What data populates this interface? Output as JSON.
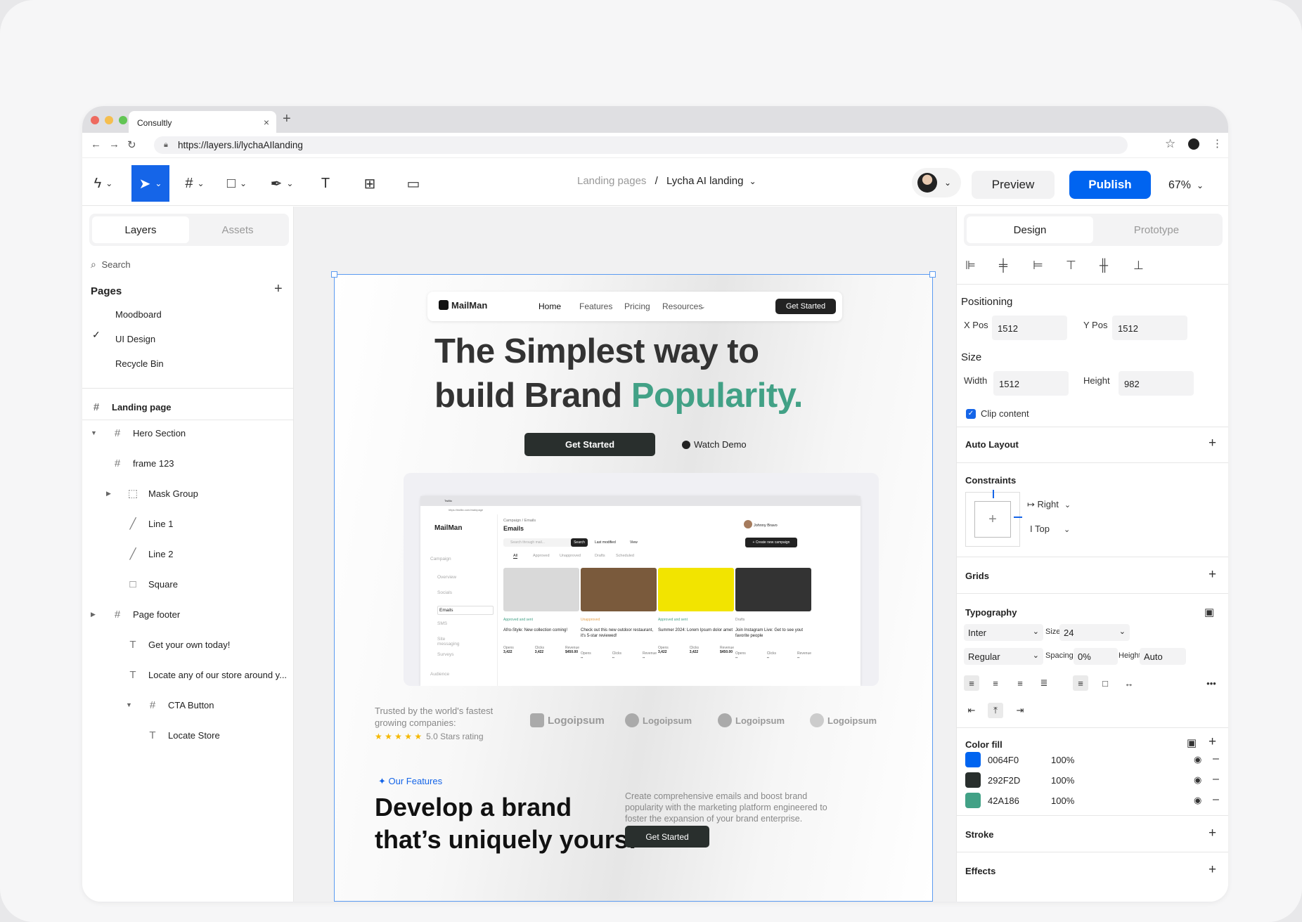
{
  "browser": {
    "tab_title": "Consultly",
    "tab_close": "×",
    "new_tab": "+",
    "url": "https://layers.li/lychaAIlanding",
    "traffic_colors": [
      "#ee6a5f",
      "#f5be4f",
      "#62c554"
    ]
  },
  "toolbar": {
    "breadcrumb_parent": "Landing pages",
    "breadcrumb_sep": "/",
    "breadcrumb_current": "Lycha AI landing",
    "preview_label": "Preview",
    "publish_label": "Publish",
    "zoom": "67%",
    "tools": [
      "logo-menu",
      "move",
      "frame",
      "shape",
      "pen",
      "text",
      "components",
      "comment"
    ]
  },
  "left": {
    "tabs": [
      "Layers",
      "Assets"
    ],
    "search_placeholder": "Search",
    "pages_title": "Pages",
    "pages": [
      "Moodboard",
      "UI Design",
      "Recycle Bin"
    ],
    "active_page": "UI Design",
    "root_frame": "Landing page",
    "layers": [
      {
        "label": "Hero Section",
        "icon": "frame",
        "depth": 0,
        "expand": "open"
      },
      {
        "label": "frame 123",
        "icon": "frame",
        "depth": 0,
        "expand": ""
      },
      {
        "label": "Mask Group",
        "icon": "mask",
        "depth": 1,
        "expand": "closed"
      },
      {
        "label": "Line 1",
        "icon": "line",
        "depth": 1,
        "expand": ""
      },
      {
        "label": "Line 2",
        "icon": "line",
        "depth": 1,
        "expand": ""
      },
      {
        "label": "Square",
        "icon": "square",
        "depth": 1,
        "expand": ""
      },
      {
        "label": "Page footer",
        "icon": "frame",
        "depth": 0,
        "expand": "closed"
      },
      {
        "label": "Get your own today!",
        "icon": "text",
        "depth": 1,
        "expand": ""
      },
      {
        "label": "Locate any of our store around y...",
        "icon": "text",
        "depth": 1,
        "expand": ""
      },
      {
        "label": "CTA Button",
        "icon": "frame",
        "depth": 2,
        "expand": "open"
      },
      {
        "label": "Locate Store",
        "icon": "text",
        "depth": 3,
        "expand": ""
      }
    ]
  },
  "canvas": {
    "nav": {
      "brand": "MailMan",
      "links": [
        "Home",
        "Features",
        "Pricing",
        "Resources"
      ],
      "cta": "Get Started"
    },
    "hero_line1": "The Simplest way to",
    "hero_line2a": "build Brand ",
    "hero_line2b": "Popularity.",
    "hero_cta": "Get Started",
    "hero_demo": "Watch Demo",
    "app": {
      "tab": "Twillio",
      "url": "https://twillio.com/mainpage",
      "brand": "MailMan",
      "breadcrumb": "Campaign / Emails",
      "heading": "Emails",
      "user": "Johnny Bravo",
      "search_placeholder": "Search through mail...",
      "search_btn": "Search",
      "sort": "Last modified",
      "view": "View",
      "create_btn": "+ Create new campaign",
      "filters": [
        "All",
        "Approved",
        "Unapproved",
        "Drafts",
        "Scheduled"
      ],
      "sidebar": [
        "Campaign",
        "Overview",
        "Socials",
        "Emails",
        "SMS",
        "Site messaging",
        "Surveys",
        "Audience"
      ],
      "cards": [
        {
          "tag": "Approved and sent",
          "title": "Afro-Style: New collection coming!",
          "opens": "3,422",
          "clicks": "3,422",
          "revenue": "$450.00",
          "color": "#d9d9d9"
        },
        {
          "tag": "Unapproved",
          "title": "Check out this new outdoor restaurant, it's 5-star reviewed!",
          "opens": "--",
          "clicks": "--",
          "revenue": "--",
          "color": "#7a5a3c"
        },
        {
          "tag": "Approved and sent",
          "title": "Summer 2024: Lorem Ipsum dolor amet",
          "opens": "3,422",
          "clicks": "3,422",
          "revenue": "$450.00",
          "color": "#f2e400"
        },
        {
          "tag": "Drafts",
          "title": "Join Instagram Live: Get to see yout favorite people",
          "opens": "--",
          "clicks": "--",
          "revenue": "--",
          "color": "#333333"
        }
      ],
      "stat_labels": [
        "Opens",
        "Clicks",
        "Revenue"
      ]
    },
    "trusted_line1": "Trusted by the world's fastest",
    "trusted_line2": "growing companies:",
    "rating": "5.0 Stars rating",
    "logos": [
      "Logoipsum",
      "Logoipsum",
      "Logoipsum",
      "Logoipsum"
    ],
    "features_label": "Our Features",
    "dev_line1": "Develop a brand",
    "dev_line2": "that’s uniquely yours!",
    "dev_desc": "Create comprehensive emails and boost brand popularity with the marketing platform engineered to foster the expansion of your brand enterprise.",
    "dev_cta": "Get Started"
  },
  "right": {
    "tabs": [
      "Design",
      "Prototype"
    ],
    "positioning": "Positioning",
    "xpos_label": "X Pos",
    "xpos": "1512",
    "ypos_label": "Y Pos",
    "ypos": "1512",
    "size": "Size",
    "width_label": "Width",
    "width": "1512",
    "height_label": "Height",
    "height": "982",
    "clip": "Clip content",
    "auto_layout": "Auto Layout",
    "constraints": "Constraints",
    "c_h": "Right",
    "c_v": "Top",
    "grids": "Grids",
    "typography": "Typography",
    "font": "Inter",
    "size_label": "Size",
    "font_size": "24",
    "weight": "Regular",
    "spacing_label": "Spacing",
    "spacing": "0%",
    "lh_label": "Height",
    "line_height": "Auto",
    "color_fill": "Color fill",
    "fills": [
      {
        "hex": "0064F0",
        "opacity": "100%",
        "color": "#0064f0"
      },
      {
        "hex": "292F2D",
        "opacity": "100%",
        "color": "#292f2d"
      },
      {
        "hex": "42A186",
        "opacity": "100%",
        "color": "#42a186"
      }
    ],
    "stroke": "Stroke",
    "effects": "Effects"
  }
}
